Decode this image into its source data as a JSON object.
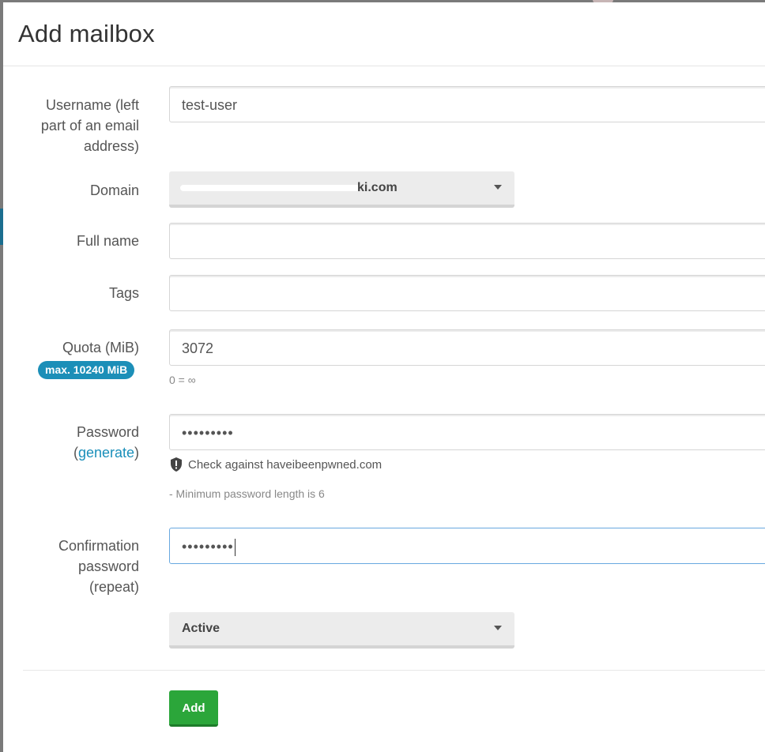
{
  "modal": {
    "title": "Add mailbox"
  },
  "form": {
    "username": {
      "label": "Username (left part of an email address)",
      "value": "test-user"
    },
    "domain": {
      "label": "Domain",
      "value": "ki.com"
    },
    "full_name": {
      "label": "Full name",
      "value": ""
    },
    "tags": {
      "label": "Tags",
      "value": ""
    },
    "quota": {
      "label": "Quota (MiB)",
      "badge": "max. 10240 MiB",
      "value": "3072",
      "hint": "0 = ∞"
    },
    "password": {
      "label_prefix": "Password",
      "label_open": "(",
      "generate_link": "generate",
      "label_close": ")",
      "value": "•••••••••",
      "check_text": "Check against haveibeenpwned.com",
      "min_length_hint": "- Minimum password length is 6"
    },
    "confirm_password": {
      "label": "Confirmation password (repeat)",
      "value": "•••••••••"
    },
    "status": {
      "value": "Active"
    },
    "add_button": "Add"
  },
  "colors": {
    "badge": "#1c8fb8",
    "link": "#1a8fba",
    "add_button": "#2ba63a",
    "focus_border": "#68a8e0"
  }
}
